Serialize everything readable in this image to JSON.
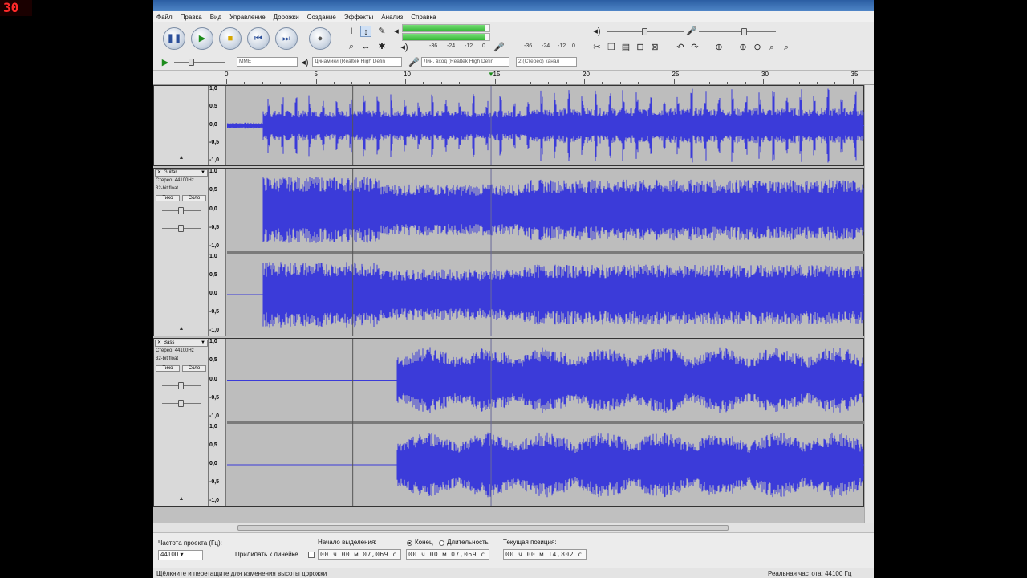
{
  "overlay": {
    "fps_counter": "30"
  },
  "menu": [
    "Файл",
    "Правка",
    "Вид",
    "Управление",
    "Дорожки",
    "Создание",
    "Эффекты",
    "Анализ",
    "Справка"
  ],
  "transport": {
    "pause": "pause-icon",
    "play": "play-icon",
    "stop": "stop-icon",
    "skip_start": "skip-start-icon",
    "skip_end": "skip-end-icon",
    "record": "record-icon"
  },
  "meters": {
    "play_level": 0.95,
    "play_scale": [
      "-36",
      "-24",
      "-12",
      "0"
    ],
    "rec_scale": [
      "-36",
      "-24",
      "-12",
      "0"
    ]
  },
  "mixer": {
    "output_volume": 0.45,
    "input_volume": 0.55
  },
  "device": {
    "host": "MME",
    "output": "Динамики (Realtek High Defin",
    "input": "Лин. вход (Realtek High Defin",
    "channels": "2 (Стерео) канал"
  },
  "ruler": {
    "ticks": [
      "0",
      "5",
      "10",
      "15",
      "20",
      "25",
      "30",
      "35"
    ]
  },
  "vscale_labels": [
    "1,0",
    "0,5",
    "0,0",
    "-0,5",
    "-1,0"
  ],
  "tracks": [
    {
      "name": "",
      "line1": "",
      "line2": "",
      "mute": "",
      "solo": ""
    },
    {
      "name": "Guitar",
      "line1": "Стерео, 44100Hz",
      "line2": "32-bit float",
      "mute": "Тихо",
      "solo": "Соло"
    },
    {
      "name": "Bass",
      "line1": "Стерео, 44100Hz",
      "line2": "32-bit float",
      "mute": "Тихо",
      "solo": "Соло"
    }
  ],
  "waveform_color": "#3b3bd9",
  "selection": {
    "project_rate_label": "Частота проекта (Гц):",
    "project_rate": "44100",
    "snap_label": "Прилипать к линейке",
    "start_label": "Начало выделения:",
    "end_label": "Конец",
    "length_label": "Длительность",
    "position_label": "Текущая позиция:",
    "start_value": "00 ч 00 м 07,069 с",
    "end_value": "00 ч 00 м 07,069 с",
    "position_value": "00 ч 00 м 14,802 с"
  },
  "status": {
    "left": "Щёлкните и перетащите для изменения высоты дорожки",
    "right": "Реальная частота: 44100 Гц"
  }
}
